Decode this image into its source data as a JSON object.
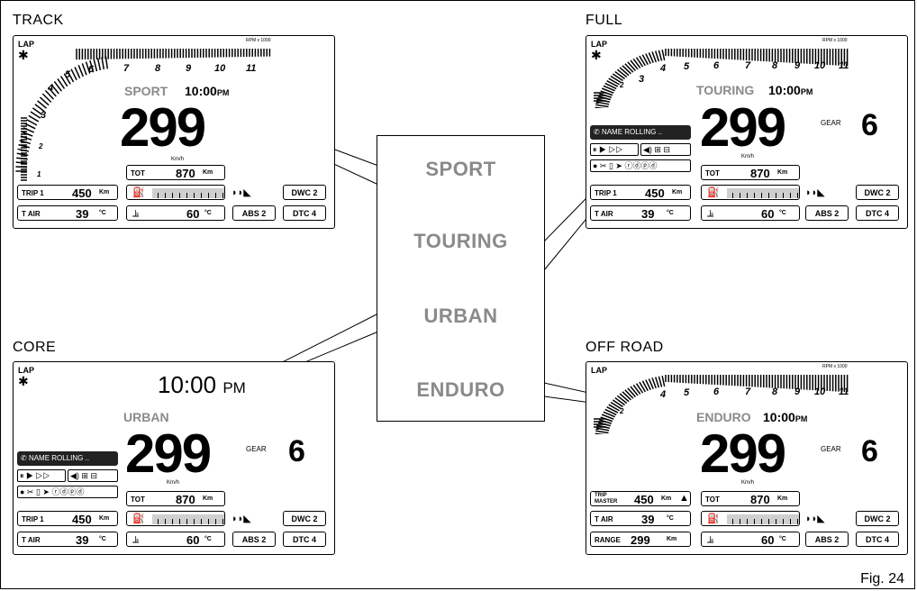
{
  "figure_label": "Fig. 24",
  "callout_modes": [
    "SPORT",
    "TOURING",
    "URBAN",
    "ENDURO"
  ],
  "panels": {
    "track": {
      "title": "TRACK",
      "lap": "LAP",
      "mode": "SPORT",
      "clock": "10:00",
      "pm": "PM",
      "rpm_unit": "RPM x 1000",
      "rpm_labels": [
        "4",
        "5",
        "6",
        "7",
        "8",
        "9",
        "10",
        "11"
      ],
      "rpm_side": [
        "1",
        "2",
        "3"
      ],
      "speed": "299",
      "speed_unit": "Km/h",
      "tot_label": "TOT",
      "tot_value": "870",
      "tot_unit": "Km",
      "trip_label": "TRIP 1",
      "trip_value": "450",
      "trip_unit": "Km",
      "tair_label": "T AIR",
      "tair_value": "39",
      "tair_unit": "°C",
      "coolant_value": "60",
      "coolant_unit": "°C",
      "dwc": "DWC 2",
      "abs": "ABS 2",
      "dtc": "DTC 4"
    },
    "full": {
      "title": "FULL",
      "lap": "LAP",
      "mode": "TOURING",
      "clock": "10:00",
      "pm": "PM",
      "rpm_unit": "RPM x 1000",
      "rpm_labels": [
        "3",
        "4",
        "5",
        "6",
        "7",
        "8",
        "9",
        "10",
        "11"
      ],
      "rpm_side": [
        "1",
        "2"
      ],
      "speed": "299",
      "speed_unit": "Km/h",
      "gear_label": "GEAR",
      "gear_value": "6",
      "phone_text": "NAME ROLLING ..",
      "tot_label": "TOT",
      "tot_value": "870",
      "tot_unit": "Km",
      "trip_label": "TRIP 1",
      "trip_value": "450",
      "trip_unit": "Km",
      "tair_label": "T AIR",
      "tair_value": "39",
      "tair_unit": "°C",
      "coolant_value": "60",
      "coolant_unit": "°C",
      "dwc": "DWC 2",
      "abs": "ABS 2",
      "dtc": "DTC 4"
    },
    "core": {
      "title": "CORE",
      "lap": "LAP",
      "mode": "URBAN",
      "clock": "10:00",
      "pm": "PM",
      "speed": "299",
      "speed_unit": "Km/h",
      "gear_label": "GEAR",
      "gear_value": "6",
      "phone_text": "NAME ROLLING ..",
      "tot_label": "TOT",
      "tot_value": "870",
      "tot_unit": "Km",
      "trip_label": "TRIP 1",
      "trip_value": "450",
      "trip_unit": "Km",
      "tair_label": "T AIR",
      "tair_value": "39",
      "tair_unit": "°C",
      "coolant_value": "60",
      "coolant_unit": "°C",
      "dwc": "DWC 2",
      "abs": "ABS 2",
      "dtc": "DTC 4"
    },
    "offroad": {
      "title": "OFF ROAD",
      "lap": "LAP",
      "mode": "ENDURO",
      "clock": "10:00",
      "pm": "PM",
      "rpm_unit": "RPM x 1000",
      "rpm_labels": [
        "4",
        "5",
        "6",
        "7",
        "8",
        "9",
        "10",
        "11"
      ],
      "rpm_side": [
        "1",
        "2"
      ],
      "speed": "299",
      "speed_unit": "Km/h",
      "gear_label": "GEAR",
      "gear_value": "6",
      "tot_label": "TOT",
      "tot_value": "870",
      "tot_unit": "Km",
      "trip_master_line1": "TRIP",
      "trip_master_line2": "MASTER",
      "trip_value": "450",
      "trip_unit": "Km",
      "tair_label": "T AIR",
      "tair_value": "39",
      "tair_unit": "°C",
      "range_label": "RANGE",
      "range_value": "299",
      "range_unit": "Km",
      "coolant_value": "60",
      "coolant_unit": "°C",
      "dwc": "DWC 2",
      "abs": "ABS 2",
      "dtc": "DTC 4"
    }
  }
}
